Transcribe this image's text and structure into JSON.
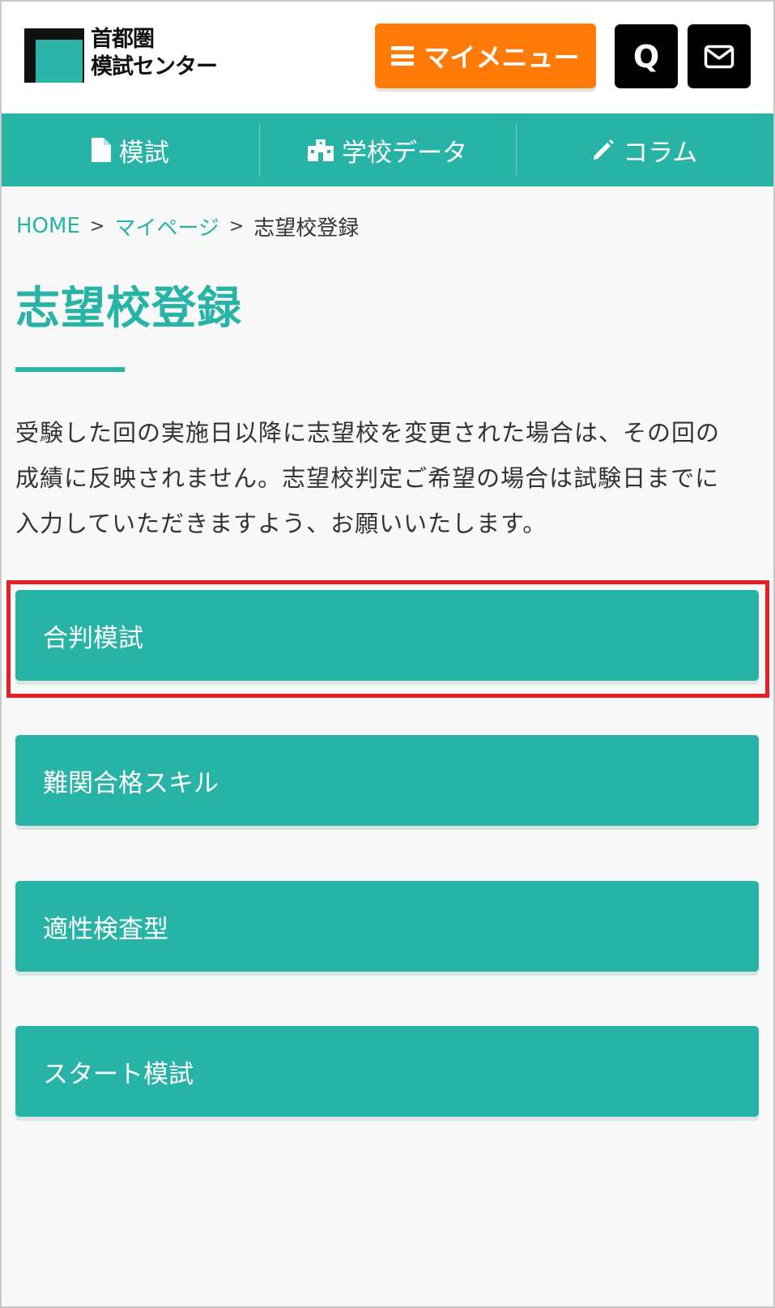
{
  "header": {
    "logo_line1": "首都圏",
    "logo_line2": "模試センター",
    "mymenu_label": "マイメニュー",
    "faq_label": "Q",
    "icons": {
      "menu": "hamburger-icon",
      "mail": "envelope-icon"
    },
    "colors": {
      "mymenu": "#ff7a06",
      "dark_buttons": "#000000"
    }
  },
  "nav": {
    "items": [
      {
        "label": "模試",
        "icon": "document-icon"
      },
      {
        "label": "学校データ",
        "icon": "school-icon"
      },
      {
        "label": "コラム",
        "icon": "pencil-icon"
      }
    ],
    "color": "#27b4a7"
  },
  "breadcrumb": {
    "home": "HOME",
    "sep": ">",
    "mypage": "マイページ",
    "current": "志望校登録"
  },
  "page": {
    "title": "志望校登録",
    "notice_lines": [
      "受験した回の実施日以降に志望校を変更された場合は、その回の",
      "成績に反映されません。志望校判定ご希望の場合は試験日までに",
      "入力していただきますよう、お願いいたします。"
    ]
  },
  "exams": [
    {
      "label": "合判模試",
      "highlighted": true
    },
    {
      "label": "難関合格スキル",
      "highlighted": false
    },
    {
      "label": "適性検査型",
      "highlighted": false
    },
    {
      "label": "スタート模試",
      "highlighted": false
    }
  ],
  "highlight_color": "#e41f26"
}
